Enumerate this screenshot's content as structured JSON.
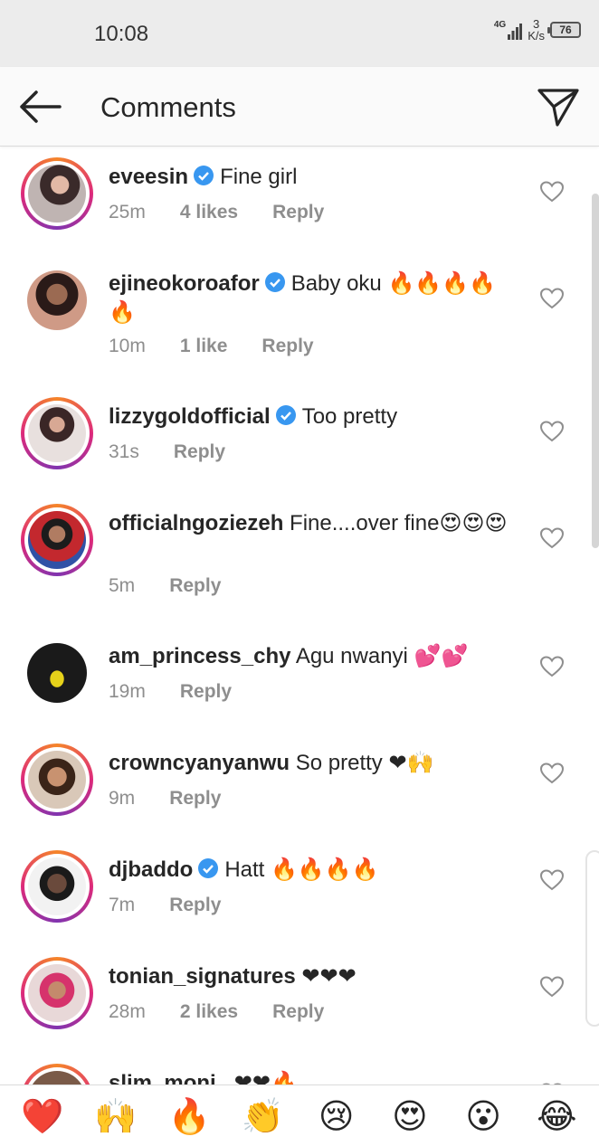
{
  "status_bar": {
    "time": "10:08",
    "network": "4G",
    "speed_value": "3",
    "speed_unit": "K/s",
    "battery": "76"
  },
  "header": {
    "title": "Comments",
    "back_icon": "back-arrow-icon",
    "send_icon": "paper-plane-icon"
  },
  "colors": {
    "text": "#262626",
    "meta": "#8e8e8e",
    "verified": "#3897f0",
    "story_ring": [
      "#f58529",
      "#dd2a7b",
      "#8134af"
    ]
  },
  "comments": [
    {
      "username": "eveesin",
      "verified": true,
      "text": "Fine girl",
      "time": "25m",
      "likes": "4 likes",
      "reply": "Reply"
    },
    {
      "username": "ejineokoroafor",
      "verified": true,
      "text": "Baby oku 🔥🔥🔥🔥🔥",
      "time": "10m",
      "likes": "1 like",
      "reply": "Reply"
    },
    {
      "username": "lizzygoldofficial",
      "verified": true,
      "text": "Too pretty",
      "time": "31s",
      "likes": "",
      "reply": "Reply"
    },
    {
      "username": "officialngoziezeh",
      "verified": false,
      "text": "Fine....over fine😍😍😍",
      "time": "5m",
      "likes": "",
      "reply": "Reply"
    },
    {
      "username": "am_princess_chy",
      "verified": false,
      "text": "Agu nwanyi 💕💕",
      "time": "19m",
      "likes": "",
      "reply": "Reply"
    },
    {
      "username": "crowncyanyanwu",
      "verified": false,
      "text": "So pretty ❤🙌",
      "time": "9m",
      "likes": "",
      "reply": "Reply"
    },
    {
      "username": "djbaddo",
      "verified": true,
      "text": "Hatt 🔥🔥🔥🔥",
      "time": "7m",
      "likes": "",
      "reply": "Reply"
    },
    {
      "username": "tonian_signatures",
      "verified": false,
      "text": "❤❤❤",
      "time": "28m",
      "likes": "2 likes",
      "reply": "Reply"
    },
    {
      "username": "slim_moni_",
      "verified": false,
      "text": "❤❤🔥",
      "time": "",
      "likes": "",
      "reply": ""
    }
  ],
  "emoji_bar": [
    "❤️",
    "🙌",
    "🔥",
    "👏",
    "😢",
    "😍",
    "😮",
    "😂"
  ]
}
